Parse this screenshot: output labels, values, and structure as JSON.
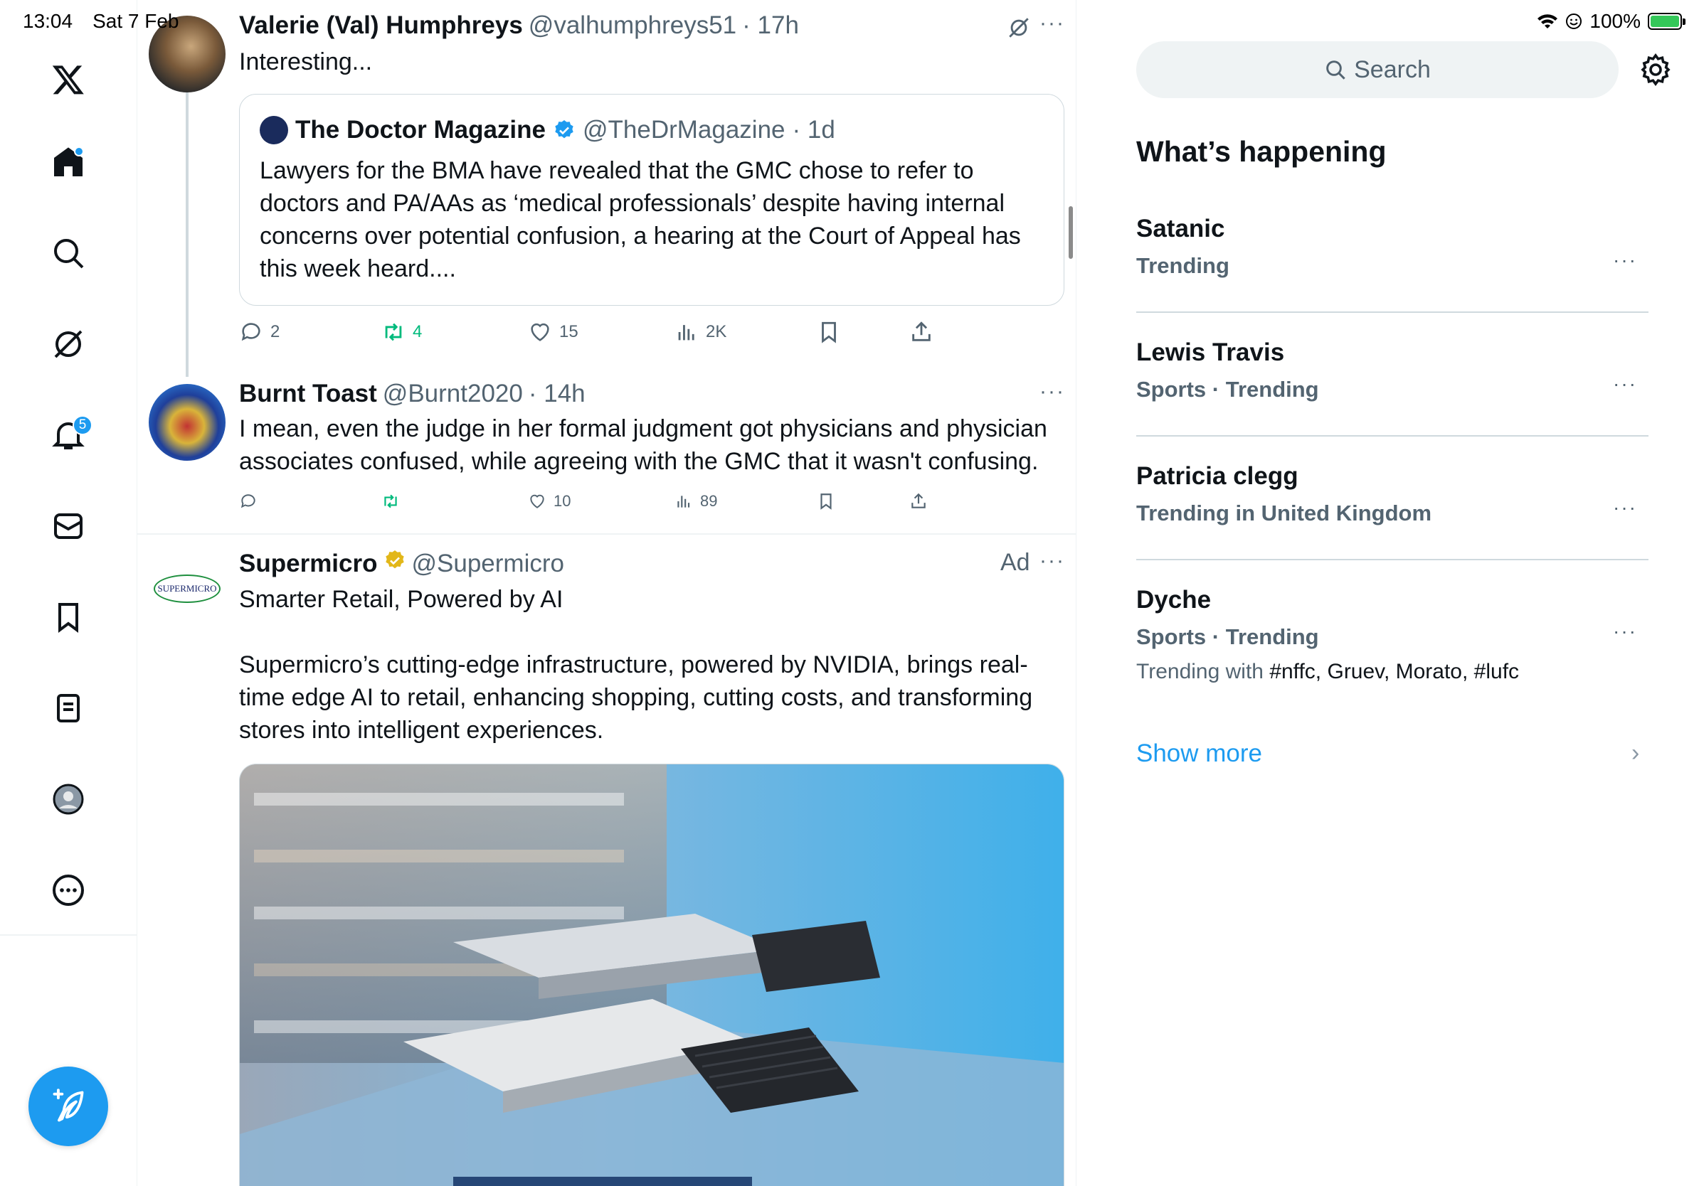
{
  "status_bar": {
    "time": "13:04",
    "date": "Sat 7 Feb",
    "battery": "100%"
  },
  "nav": {
    "notifications_badge": "5",
    "items": [
      "x-logo",
      "home",
      "explore",
      "grok",
      "notifications",
      "messages",
      "bookmarks",
      "lists",
      "profile",
      "more"
    ]
  },
  "colors": {
    "accent": "#1d9bf0",
    "muted": "#536471",
    "retweet_green": "#00ba7c"
  },
  "tweets": [
    {
      "name": "Valerie (Val) Humphreys",
      "handle": "@valhumphreys51",
      "time": "· 17h",
      "text": "Interesting...",
      "quote": {
        "name": "The Doctor Magazine",
        "handle": "@TheDrMagazine",
        "time": "· 1d",
        "text": "Lawyers for the BMA have revealed that the GMC chose to refer to doctors and PA/AAs as ‘medical professionals’ despite having internal concerns over potential confusion, a hearing at the Court of Appeal has this week heard...."
      },
      "stats": {
        "replies": "2",
        "reposts": "4",
        "likes": "15",
        "views": "2K"
      }
    },
    {
      "name": "Burnt Toast",
      "handle": "@Burnt2020",
      "time": "· 14h",
      "text": "I mean, even the judge in her formal judgment got physicians and physician associates confused, while agreeing with the GMC that it wasn't confusing.",
      "stats": {
        "likes": "10",
        "views": "89"
      }
    },
    {
      "name": "Supermicro",
      "handle": "@Supermicro",
      "ad_label": "Ad",
      "text": "Smarter Retail, Powered by AI\n\nSupermicro’s cutting-edge infrastructure, powered by NVIDIA, brings real-time edge AI to retail, enhancing shopping, cutting costs, and transforming stores into intelligent experiences.",
      "avatar_text": "SUPERMICRO"
    }
  ],
  "sidebar": {
    "search_placeholder": "Search",
    "whats_happening": "What’s happening",
    "trends": [
      {
        "name": "Satanic",
        "meta": "Trending"
      },
      {
        "name": "Lewis Travis",
        "meta": "Sports · Trending"
      },
      {
        "name": "Patricia clegg",
        "meta": "Trending in United Kingdom"
      },
      {
        "name": "Dyche",
        "meta": "Sports · Trending",
        "with_prefix": "Trending with ",
        "with_tags": "#nffc, Gruev, Morato, #lufc"
      }
    ],
    "show_more": "Show more"
  }
}
